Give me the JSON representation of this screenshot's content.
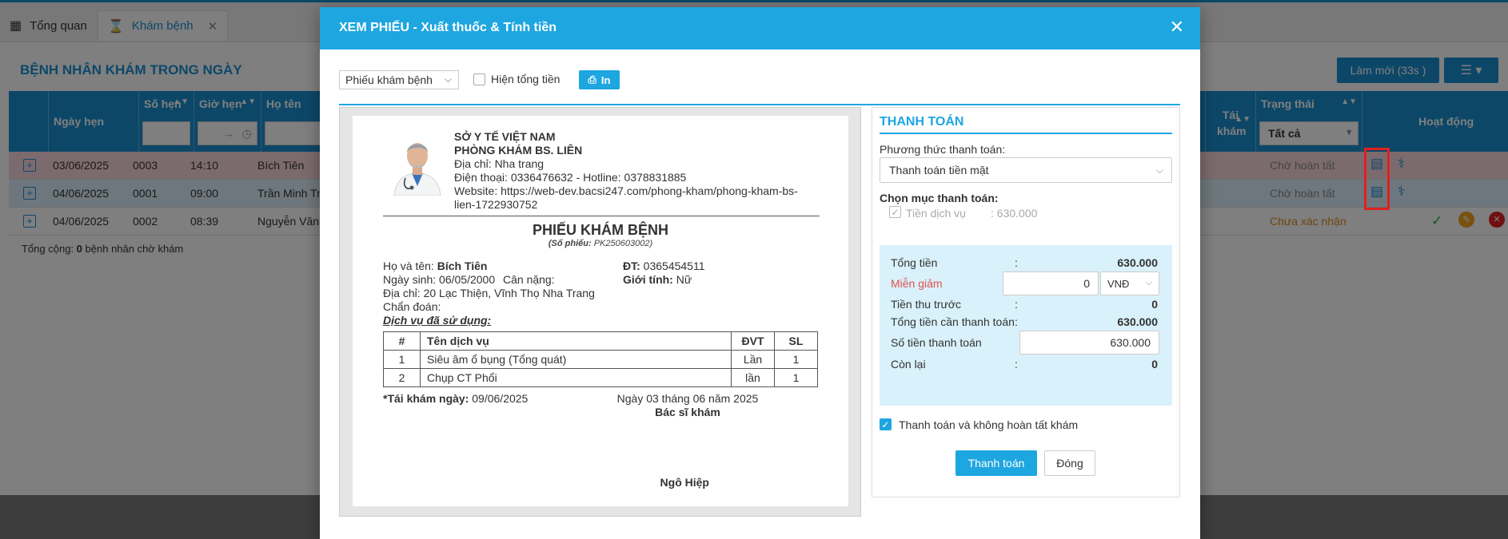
{
  "tabs": [
    {
      "label": "Tổng quan",
      "icon": "dashboard-icon"
    },
    {
      "label": "Khám bệnh",
      "icon": "hourglass-icon"
    }
  ],
  "page": {
    "title": "BỆNH NHÂN KHÁM TRONG NGÀY",
    "refresh_label": "Làm mới (33s )",
    "footer_prefix": "Tổng cộng:",
    "footer_count": "0",
    "footer_suffix": "bệnh nhân chờ khám"
  },
  "grid": {
    "columns": {
      "date": "Ngày hẹn",
      "appt_no": "Số hẹn",
      "appt_time": "Giờ hẹn",
      "name": "Họ tên",
      "revisit": "Tái khám",
      "status": "Trạng thái",
      "actions": "Hoạt động"
    },
    "status_filter": "Tất cả",
    "time_filter_arrow": "→",
    "rows": [
      {
        "date": "03/06/2025",
        "no": "0003",
        "time": "14:10",
        "name": "Bích Tiên",
        "status": "Chờ hoàn tất"
      },
      {
        "date": "04/06/2025",
        "no": "0001",
        "time": "09:00",
        "name": "Trần Minh Tr",
        "status": "Chờ hoàn tất"
      },
      {
        "date": "04/06/2025",
        "no": "0002",
        "time": "08:39",
        "name": "Nguyễn Văn",
        "status": "Chưa xác nhận"
      }
    ]
  },
  "modal": {
    "title": "XEM PHIẾU - Xuất thuốc & Tính tiền",
    "doc_select": "Phiếu khám bệnh",
    "show_total_label": "Hiện tổng tiền",
    "print_label": "In"
  },
  "paper": {
    "org": "SỞ Y TẾ VIỆT NAM",
    "clinic": "PHÒNG KHÁM BS. LIÊN",
    "address": "Địa chỉ: Nha trang",
    "phone": "Điện thoại: 0336476632 - Hotline: 0378831885",
    "website_1": "Website: https://web-dev.bacsi247.com/phong-kham/phong-kham-bs-",
    "website_2": "lien-1722930752",
    "title": "PHIẾU KHÁM BỆNH",
    "subtitle_label": "(Số phiếu:",
    "subtitle_value": "PK250603002)",
    "name_label": "Họ và tên:",
    "name_value": "Bích Tiên",
    "phone_label": "ĐT:",
    "phone_value": "0365454511",
    "dob": "Ngày sinh: 06/05/2000",
    "weight": "Cân nặng:",
    "gender_label": "Giới tính:",
    "gender_value": "Nữ",
    "patient_address": "Địa chỉ: 20 Lạc Thiện, Vĩnh Thọ Nha Trang",
    "diagnosis": "Chẩn đoán:",
    "services_title": "Dịch vụ đã sử dụng:",
    "table_headers": [
      "#",
      "Tên dịch vụ",
      "ĐVT",
      "SL"
    ],
    "services": [
      {
        "idx": "1",
        "name": "Siêu âm ổ bụng (Tổng quát)",
        "unit": "Lần",
        "qty": "1"
      },
      {
        "idx": "2",
        "name": "Chụp CT Phổi",
        "unit": "lần",
        "qty": "1"
      }
    ],
    "revisit_label": "*Tái khám ngày:",
    "revisit_value": "09/06/2025",
    "date_line": "Ngày 03 tháng 06 năm 2025",
    "doctor_label": "Bác sĩ khám",
    "doctor_name": "Ngô Hiệp"
  },
  "payment": {
    "title": "THANH TOÁN",
    "method_label": "Phương thức thanh toán:",
    "method_value": "Thanh toán tiền mặt",
    "items_label": "Chọn mục thanh toán:",
    "service_fee_label": "Tiền dịch vụ",
    "service_fee_value": ": 630.000",
    "total_label": "Tổng tiền",
    "total_value": "630.000",
    "discount_label": "Miễn giảm",
    "discount_value": "0",
    "currency": "VNĐ",
    "prepaid_label": "Tiền thu trước",
    "prepaid_value": "0",
    "due_label": "Tổng tiền cần thanh toán",
    "due_value": "630.000",
    "paid_label": "Số tiền thanh toán",
    "paid_value": "630.000",
    "remain_label": "Còn lại",
    "remain_value": "0",
    "colon": ":",
    "no_complete_label": "Thanh toán và không hoàn tất khám",
    "pay_button": "Thanh toán",
    "close_button": "Đóng"
  }
}
